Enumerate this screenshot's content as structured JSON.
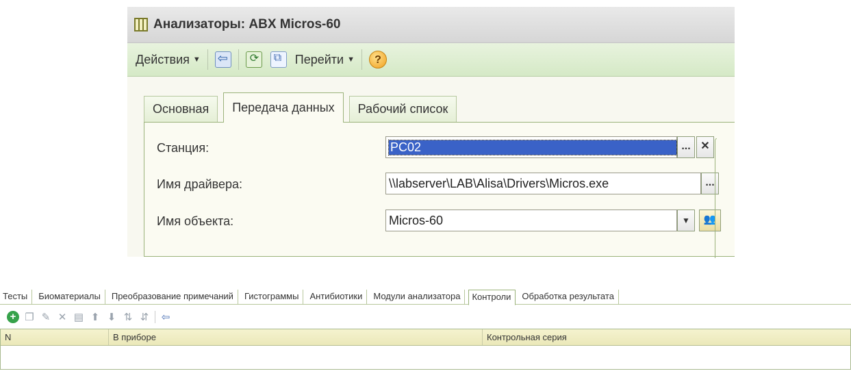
{
  "window": {
    "title": "Анализаторы: ABX Micros-60"
  },
  "toolbar": {
    "actions_label": "Действия",
    "goto_label": "Перейти",
    "help_label": "?"
  },
  "tabs": [
    {
      "label": "Основная"
    },
    {
      "label": "Передача данных"
    },
    {
      "label": "Рабочий список"
    }
  ],
  "form": {
    "station_label": "Станция:",
    "station_value": "PC02",
    "station_select_label": "...",
    "station_clear_label": "✕",
    "driver_label": "Имя драйвера:",
    "driver_value": "\\\\labserver\\LAB\\Alisa\\Drivers\\Micros.exe",
    "driver_select_label": "...",
    "object_label": "Имя объекта:",
    "object_value": "Micros-60",
    "object_dropdown_label": "▼"
  },
  "bottom_tabs": [
    {
      "label": "Тесты"
    },
    {
      "label": "Биоматериалы"
    },
    {
      "label": "Преобразование примечаний"
    },
    {
      "label": "Гистограммы"
    },
    {
      "label": "Антибиотики"
    },
    {
      "label": "Модули анализатора"
    },
    {
      "label": "Контроли"
    },
    {
      "label": "Обработка результата"
    }
  ],
  "bottom_toolbar_icons": [
    "add-icon",
    "copy-icon",
    "edit-icon",
    "delete-icon",
    "save-icon",
    "move-up-icon",
    "move-down-icon",
    "sort-asc-icon",
    "sort-desc-icon",
    "enter-icon"
  ],
  "grid": {
    "columns": [
      "N",
      "В приборе",
      "Контрольная серия"
    ]
  }
}
